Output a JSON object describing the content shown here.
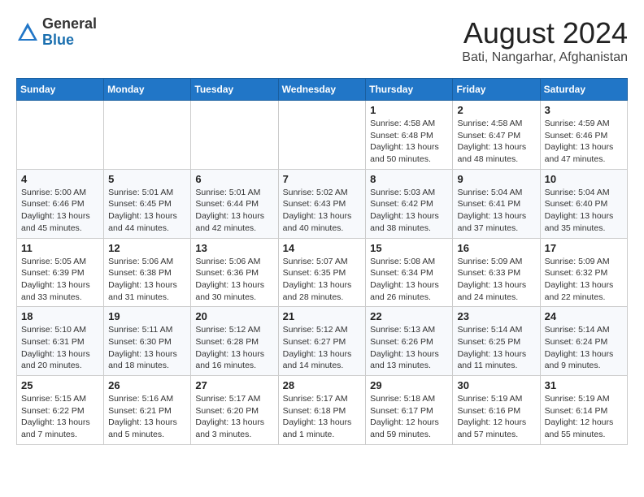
{
  "logo": {
    "general": "General",
    "blue": "Blue"
  },
  "title": "August 2024",
  "subtitle": "Bati, Nangarhar, Afghanistan",
  "days_header": [
    "Sunday",
    "Monday",
    "Tuesday",
    "Wednesday",
    "Thursday",
    "Friday",
    "Saturday"
  ],
  "weeks": [
    [
      {
        "day": "",
        "detail": ""
      },
      {
        "day": "",
        "detail": ""
      },
      {
        "day": "",
        "detail": ""
      },
      {
        "day": "",
        "detail": ""
      },
      {
        "day": "1",
        "detail": "Sunrise: 4:58 AM\nSunset: 6:48 PM\nDaylight: 13 hours\nand 50 minutes."
      },
      {
        "day": "2",
        "detail": "Sunrise: 4:58 AM\nSunset: 6:47 PM\nDaylight: 13 hours\nand 48 minutes."
      },
      {
        "day": "3",
        "detail": "Sunrise: 4:59 AM\nSunset: 6:46 PM\nDaylight: 13 hours\nand 47 minutes."
      }
    ],
    [
      {
        "day": "4",
        "detail": "Sunrise: 5:00 AM\nSunset: 6:46 PM\nDaylight: 13 hours\nand 45 minutes."
      },
      {
        "day": "5",
        "detail": "Sunrise: 5:01 AM\nSunset: 6:45 PM\nDaylight: 13 hours\nand 44 minutes."
      },
      {
        "day": "6",
        "detail": "Sunrise: 5:01 AM\nSunset: 6:44 PM\nDaylight: 13 hours\nand 42 minutes."
      },
      {
        "day": "7",
        "detail": "Sunrise: 5:02 AM\nSunset: 6:43 PM\nDaylight: 13 hours\nand 40 minutes."
      },
      {
        "day": "8",
        "detail": "Sunrise: 5:03 AM\nSunset: 6:42 PM\nDaylight: 13 hours\nand 38 minutes."
      },
      {
        "day": "9",
        "detail": "Sunrise: 5:04 AM\nSunset: 6:41 PM\nDaylight: 13 hours\nand 37 minutes."
      },
      {
        "day": "10",
        "detail": "Sunrise: 5:04 AM\nSunset: 6:40 PM\nDaylight: 13 hours\nand 35 minutes."
      }
    ],
    [
      {
        "day": "11",
        "detail": "Sunrise: 5:05 AM\nSunset: 6:39 PM\nDaylight: 13 hours\nand 33 minutes."
      },
      {
        "day": "12",
        "detail": "Sunrise: 5:06 AM\nSunset: 6:38 PM\nDaylight: 13 hours\nand 31 minutes."
      },
      {
        "day": "13",
        "detail": "Sunrise: 5:06 AM\nSunset: 6:36 PM\nDaylight: 13 hours\nand 30 minutes."
      },
      {
        "day": "14",
        "detail": "Sunrise: 5:07 AM\nSunset: 6:35 PM\nDaylight: 13 hours\nand 28 minutes."
      },
      {
        "day": "15",
        "detail": "Sunrise: 5:08 AM\nSunset: 6:34 PM\nDaylight: 13 hours\nand 26 minutes."
      },
      {
        "day": "16",
        "detail": "Sunrise: 5:09 AM\nSunset: 6:33 PM\nDaylight: 13 hours\nand 24 minutes."
      },
      {
        "day": "17",
        "detail": "Sunrise: 5:09 AM\nSunset: 6:32 PM\nDaylight: 13 hours\nand 22 minutes."
      }
    ],
    [
      {
        "day": "18",
        "detail": "Sunrise: 5:10 AM\nSunset: 6:31 PM\nDaylight: 13 hours\nand 20 minutes."
      },
      {
        "day": "19",
        "detail": "Sunrise: 5:11 AM\nSunset: 6:30 PM\nDaylight: 13 hours\nand 18 minutes."
      },
      {
        "day": "20",
        "detail": "Sunrise: 5:12 AM\nSunset: 6:28 PM\nDaylight: 13 hours\nand 16 minutes."
      },
      {
        "day": "21",
        "detail": "Sunrise: 5:12 AM\nSunset: 6:27 PM\nDaylight: 13 hours\nand 14 minutes."
      },
      {
        "day": "22",
        "detail": "Sunrise: 5:13 AM\nSunset: 6:26 PM\nDaylight: 13 hours\nand 13 minutes."
      },
      {
        "day": "23",
        "detail": "Sunrise: 5:14 AM\nSunset: 6:25 PM\nDaylight: 13 hours\nand 11 minutes."
      },
      {
        "day": "24",
        "detail": "Sunrise: 5:14 AM\nSunset: 6:24 PM\nDaylight: 13 hours\nand 9 minutes."
      }
    ],
    [
      {
        "day": "25",
        "detail": "Sunrise: 5:15 AM\nSunset: 6:22 PM\nDaylight: 13 hours\nand 7 minutes."
      },
      {
        "day": "26",
        "detail": "Sunrise: 5:16 AM\nSunset: 6:21 PM\nDaylight: 13 hours\nand 5 minutes."
      },
      {
        "day": "27",
        "detail": "Sunrise: 5:17 AM\nSunset: 6:20 PM\nDaylight: 13 hours\nand 3 minutes."
      },
      {
        "day": "28",
        "detail": "Sunrise: 5:17 AM\nSunset: 6:18 PM\nDaylight: 13 hours\nand 1 minute."
      },
      {
        "day": "29",
        "detail": "Sunrise: 5:18 AM\nSunset: 6:17 PM\nDaylight: 12 hours\nand 59 minutes."
      },
      {
        "day": "30",
        "detail": "Sunrise: 5:19 AM\nSunset: 6:16 PM\nDaylight: 12 hours\nand 57 minutes."
      },
      {
        "day": "31",
        "detail": "Sunrise: 5:19 AM\nSunset: 6:14 PM\nDaylight: 12 hours\nand 55 minutes."
      }
    ]
  ]
}
